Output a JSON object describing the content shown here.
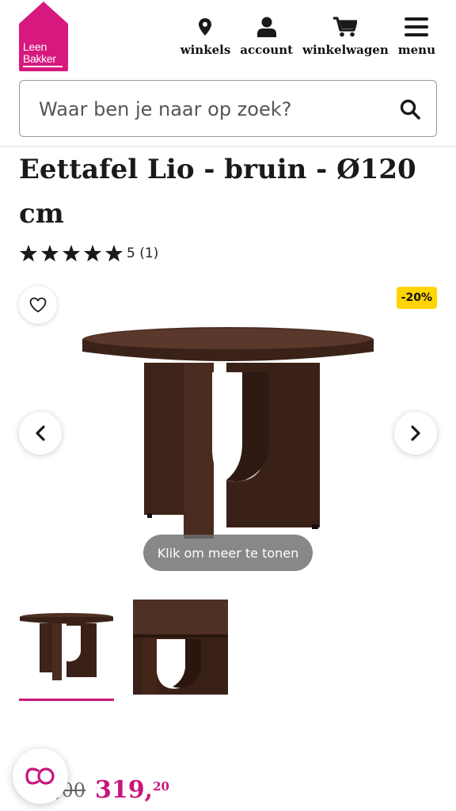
{
  "brand": {
    "logo_line1": "Leen",
    "logo_line2": "Bakker",
    "color": "#d7187f"
  },
  "nav": {
    "items": [
      {
        "label": "winkels",
        "icon": "map-pin-icon"
      },
      {
        "label": "account",
        "icon": "user-icon"
      },
      {
        "label": "winkelwagen",
        "icon": "cart-icon"
      },
      {
        "label": "menu",
        "icon": "hamburger-menu-icon"
      }
    ]
  },
  "search": {
    "placeholder": "Waar ben je naar op zoek?",
    "value": ""
  },
  "product": {
    "title": "Eettafel Lio - bruin - Ø120 cm",
    "rating_value": 5,
    "rating_text": "5 (1)",
    "discount_badge": "-20%",
    "show_more_label": "Klik om meer te tonen",
    "old_price": "399,00",
    "price_main": "319,",
    "price_cents": "20",
    "accent_color": "#c8157c",
    "badge_color": "#ffd400"
  },
  "gallery": {
    "thumbnail_count": 2,
    "active_thumbnail": 1
  }
}
